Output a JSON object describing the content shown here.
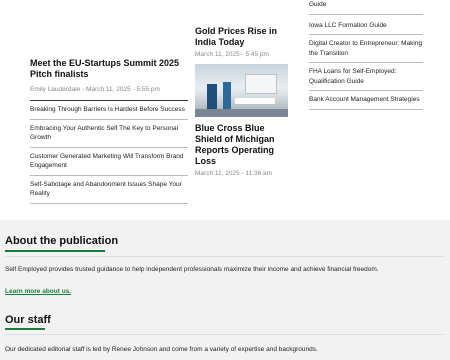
{
  "left_column": {
    "lead_title": "Meet the EU-Startups Summit 2025 Pitch finalists",
    "lead_byline": "Emily Lauderdale - March 11, 2025 - 5:55 pm",
    "links": [
      "Breaking Through Barriers Is Hardest Before Success",
      "Embracing Your Authentic Self The Key to Personal Growth",
      "Customer Generated Marketing Will Transform Brand Engagement",
      "Self-Sabotage and Abandonment Issues Shape Your Reality"
    ]
  },
  "middle_column": {
    "article1_title": "Gold Prices Rise in India Today",
    "article1_date": "March 11, 2025 - 5:45 pm",
    "article2_title": "Blue Cross Blue Shield of Michigan Reports Operating Loss",
    "article2_date": "March 11, 2025 - 11:36 am"
  },
  "right_column": {
    "links": [
      "Guide",
      "Iowa LLC Formation Guide",
      "Digital Creator to Entrepreneur: Making the Transition",
      "FHA Loans for Self-Employed: Qualification Guide",
      "Bank Account Management Strategies"
    ]
  },
  "about": {
    "heading": "About the publication",
    "text": "Self Employed provides trusted guidance to help independent professionals maximize their income and achieve financial freedom.",
    "link": "Learn more about us."
  },
  "staff": {
    "heading": "Our staff",
    "text": "Our dedicated editorial staff is led by Renee Johnson and come from a variety of expertise and backgrounds."
  }
}
